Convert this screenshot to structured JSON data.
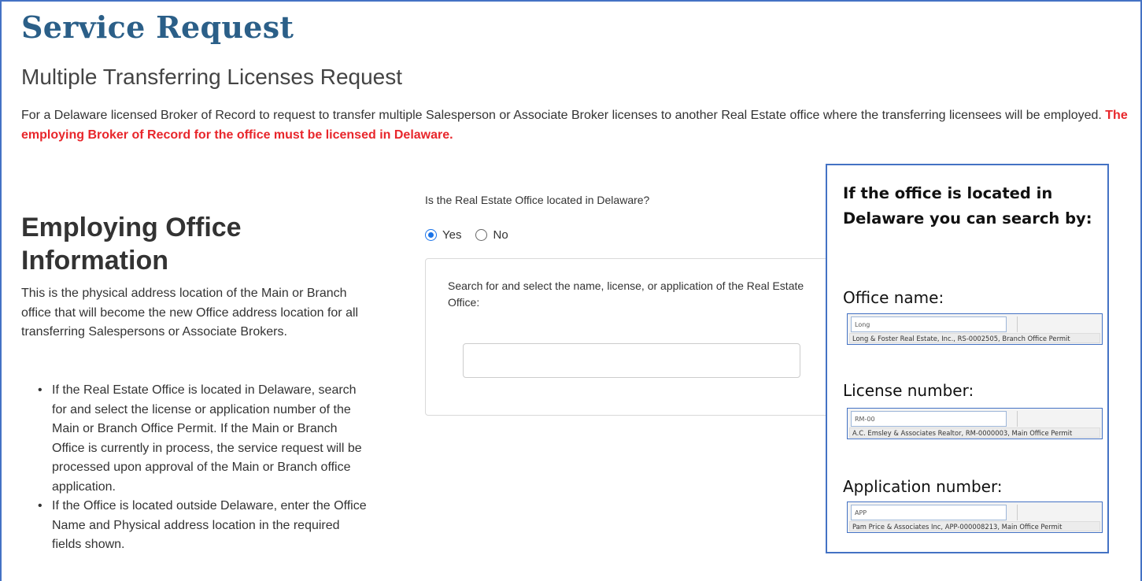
{
  "header": {
    "title": "Service Request",
    "subtitle": "Multiple Transferring Licenses Request",
    "intro": "For a Delaware licensed Broker of Record to request to transfer multiple Salesperson or Associate Broker licenses to another Real Estate office where the transferring licensees will be employed.",
    "warning": "The employing Broker of Record for the office must be licensed in Delaware."
  },
  "section": {
    "heading": "Employing Office Information",
    "description": "This is the physical address location of the Main or Branch office that will become the new Office address location for all transferring Salespersons or Associate Brokers.",
    "bullets": [
      "If the Real Estate Office is located in Delaware, search for and select the license or application number of the Main or Branch Office Permit. If the Main or Branch Office is currently in process, the service request will be processed upon approval of the Main or Branch office application.",
      "If the Office is located outside Delaware, enter the Office Name and Physical address location in the required fields shown."
    ]
  },
  "form": {
    "question": "Is the Real Estate Office located in Delaware?",
    "options": [
      {
        "label": "Yes",
        "selected": true
      },
      {
        "label": "No",
        "selected": false
      }
    ],
    "search_label": "Search for and select the name, license, or application of the Real Estate Office:",
    "search_value": ""
  },
  "callout": {
    "title": "If the office is located in Delaware you can search by:",
    "examples": [
      {
        "label": "Office name:",
        "input": "Long",
        "result": "Long & Foster Real Estate, Inc., RS-0002505, Branch Office Permit"
      },
      {
        "label": "License number:",
        "input": "RM-00",
        "result": "A.C. Emsley & Associates Realtor, RM-0000003, Main Office Permit"
      },
      {
        "label": "Application number:",
        "input": "APP",
        "result": "Pam Price & Associates Inc, APP-000008213, Main Office Permit"
      }
    ]
  },
  "colors": {
    "title": "#2b5f88",
    "warning": "#e8262b",
    "frame": "#4472c4",
    "radio_selected": "#1a73e8"
  }
}
